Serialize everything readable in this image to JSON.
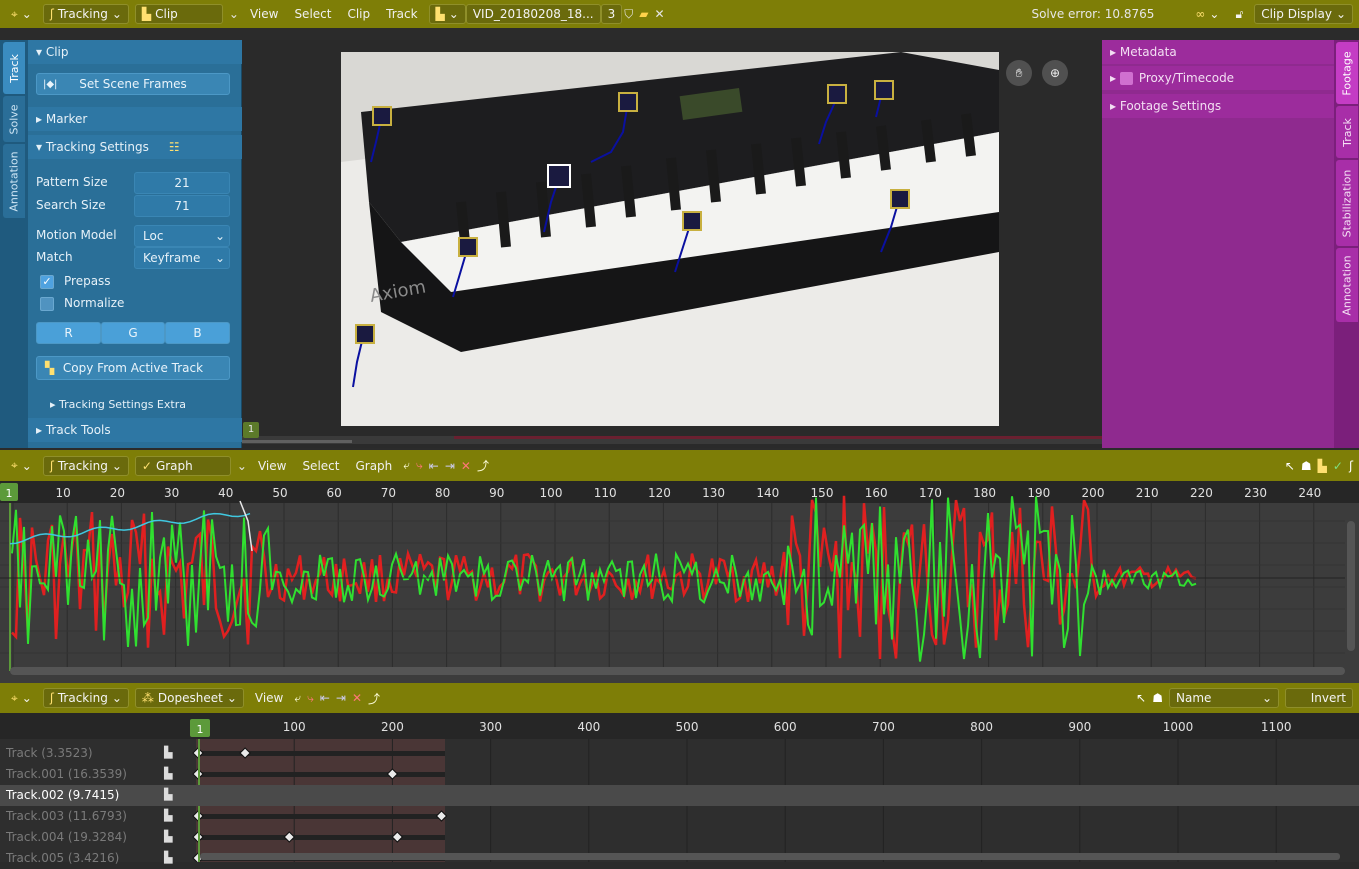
{
  "top_header": {
    "editor_type_icon": "crosshair-icon",
    "workspace": "Tracking",
    "mode": "Clip",
    "menus": [
      "View",
      "Select",
      "Clip",
      "Track"
    ],
    "clip_name": "VID_20180208_18...",
    "clip_users": "3",
    "solve_error": "Solve error: 10.8765",
    "clip_display": "Clip Display"
  },
  "left_tabs": [
    "Track",
    "Solve",
    "Annotation"
  ],
  "left_panel": {
    "clip_title": "Clip",
    "set_scene_frames": "Set Scene Frames",
    "marker_title": "Marker",
    "tracking_settings_title": "Tracking Settings",
    "pattern_size_label": "Pattern Size",
    "pattern_size": "21",
    "search_size_label": "Search Size",
    "search_size": "71",
    "motion_model_label": "Motion Model",
    "motion_model": "Loc",
    "match_label": "Match",
    "match": "Keyframe",
    "prepass": "Prepass",
    "prepass_checked": true,
    "normalize": "Normalize",
    "normalize_checked": false,
    "channels": [
      "R",
      "G",
      "B"
    ],
    "copy_from_active": "Copy From Active Track",
    "tracking_settings_extra": "Tracking Settings Extra",
    "track_tools_title": "Track Tools",
    "current_frame_badge": "1"
  },
  "right_panel": {
    "items": [
      "Metadata",
      "Proxy/Timecode",
      "Footage Settings"
    ],
    "tabs": [
      "Footage",
      "Track",
      "Stabilization",
      "Annotation"
    ]
  },
  "graph_header": {
    "workspace": "Tracking",
    "mode": "Graph",
    "menus": [
      "View",
      "Select",
      "Graph"
    ]
  },
  "graph_ruler": {
    "current_frame": "1",
    "ticks": [
      "10",
      "20",
      "30",
      "40",
      "50",
      "60",
      "70",
      "80",
      "90",
      "100",
      "110",
      "120",
      "130",
      "140",
      "150",
      "160",
      "170",
      "180",
      "190",
      "200",
      "210",
      "220",
      "230",
      "240"
    ]
  },
  "dope_header": {
    "workspace": "Tracking",
    "mode": "Dopesheet",
    "menus": [
      "View"
    ],
    "sort": "Name",
    "invert": "Invert"
  },
  "dope_ruler": {
    "current_frame": "1",
    "ticks": [
      "100",
      "200",
      "300",
      "400",
      "500",
      "600",
      "700",
      "800",
      "900",
      "1000",
      "1100"
    ]
  },
  "tracks": [
    {
      "name": "Track (3.3523)",
      "active": false
    },
    {
      "name": "Track.001 (16.3539)",
      "active": false
    },
    {
      "name": "Track.002 (9.7415)",
      "active": true
    },
    {
      "name": "Track.003 (11.6793)",
      "active": false
    },
    {
      "name": "Track.004 (19.3284)",
      "active": false
    },
    {
      "name": "Track.005 (3.4216)",
      "active": false
    }
  ],
  "colors": {
    "header": "#7e7e07",
    "left_panel": "#2a6f98",
    "right_panel": "#8f2a8f",
    "curve_red": "#e02020",
    "curve_green": "#30e030",
    "curve_cyan": "#40c8e0",
    "active_strip": "#ff8c00"
  }
}
